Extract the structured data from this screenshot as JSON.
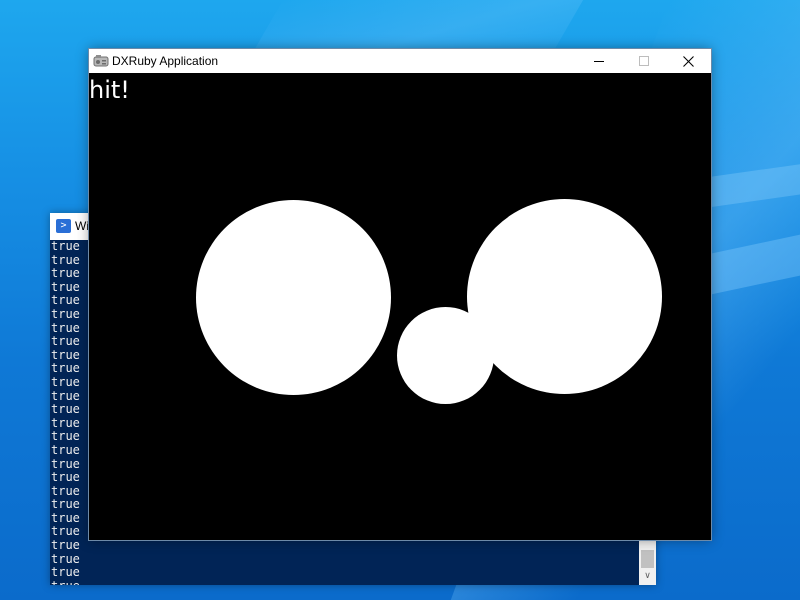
{
  "desktop": {
    "background_color": "#0f79d6"
  },
  "powershell_window": {
    "title": "Wi",
    "icon": "powershell-icon",
    "background_color": "#012456",
    "text_color": "#eeeeee",
    "output_lines": [
      "true",
      "true",
      "true",
      "true",
      "true",
      "true",
      "true",
      "true",
      "true",
      "true",
      "true",
      "true",
      "true",
      "true",
      "true",
      "true",
      "true",
      "true",
      "true",
      "true",
      "true",
      "true",
      "true",
      "true",
      "true",
      "true"
    ],
    "scroll_down_glyph": "∨"
  },
  "dxruby_window": {
    "title": "DXRuby Application",
    "icon": "dxruby-app-icon",
    "canvas": {
      "background_color": "#000000",
      "status_text": "hit!",
      "shape_color": "#ffffff",
      "shapes": [
        {
          "name": "circle-left",
          "type": "circle"
        },
        {
          "name": "circle-small",
          "type": "circle"
        },
        {
          "name": "circle-right",
          "type": "circle"
        }
      ]
    }
  }
}
